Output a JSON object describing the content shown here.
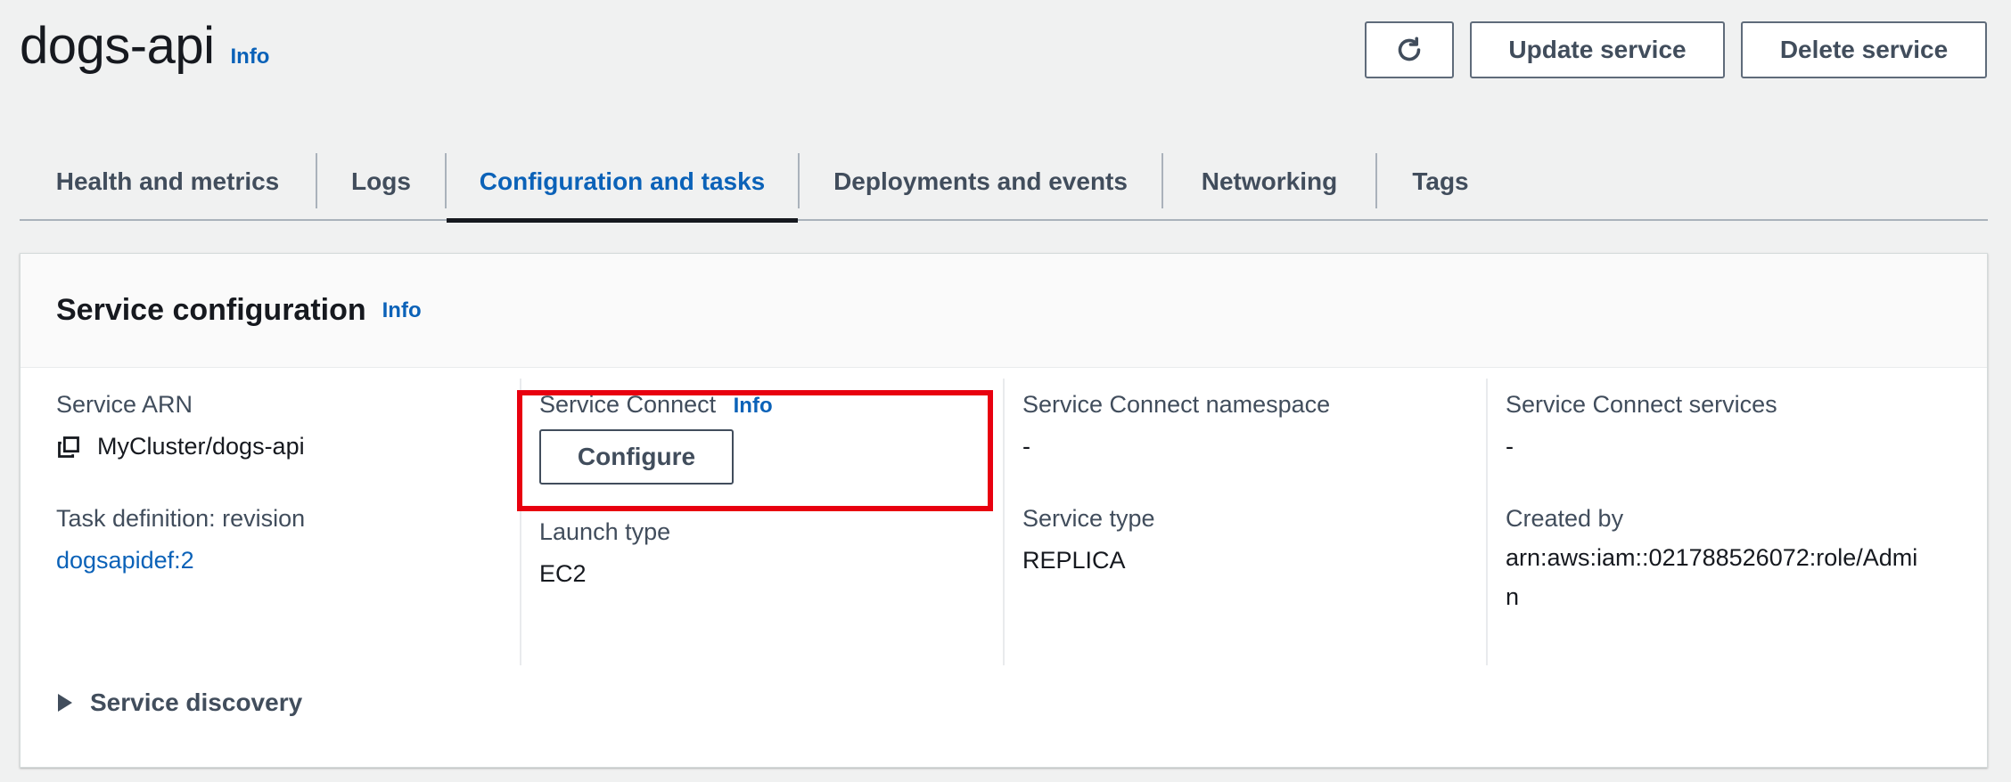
{
  "header": {
    "title": "dogs-api",
    "info": "Info",
    "update_button": "Update service",
    "delete_button": "Delete service"
  },
  "tabs": [
    {
      "label": "Health and metrics",
      "active": false
    },
    {
      "label": "Logs",
      "active": false
    },
    {
      "label": "Configuration and tasks",
      "active": true
    },
    {
      "label": "Deployments and events",
      "active": false
    },
    {
      "label": "Networking",
      "active": false
    },
    {
      "label": "Tags",
      "active": false
    }
  ],
  "service_config": {
    "title": "Service configuration",
    "info": "Info",
    "service_arn": {
      "label": "Service ARN",
      "value": "MyCluster/dogs-api"
    },
    "service_connect": {
      "label": "Service Connect",
      "info": "Info",
      "button": "Configure"
    },
    "sc_namespace": {
      "label": "Service Connect namespace",
      "value": "-"
    },
    "sc_services": {
      "label": "Service Connect services",
      "value": "-"
    },
    "task_def": {
      "label": "Task definition: revision",
      "value": "dogsapidef:2"
    },
    "launch_type": {
      "label": "Launch type",
      "value": "EC2"
    },
    "service_type": {
      "label": "Service type",
      "value": "REPLICA"
    },
    "created_by": {
      "label": "Created by",
      "value_line1": "arn:aws:iam::021788526072:role/Admi",
      "value_line2": "n"
    },
    "service_discovery": "Service discovery"
  },
  "colors": {
    "link": "#0b62b8",
    "highlight": "#e8000f",
    "active_tab_underline": "#16191f"
  },
  "icons": [
    "refresh-icon",
    "copy-icon",
    "caret-right-icon"
  ]
}
